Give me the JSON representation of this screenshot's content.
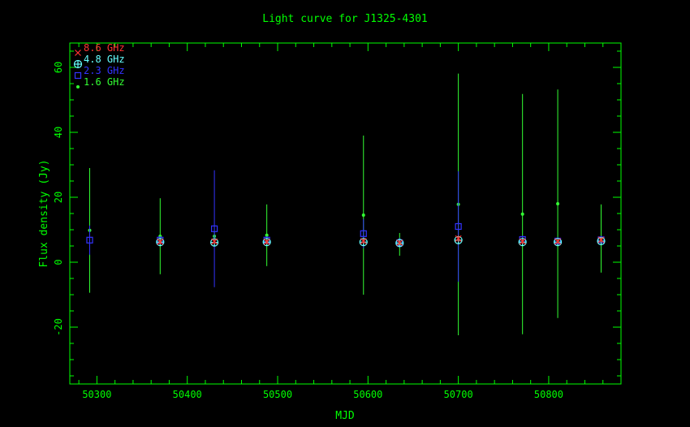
{
  "chart_data": {
    "type": "scatter",
    "title": "Light curve for J1325-4301",
    "xlabel": "MJD",
    "ylabel": "Flux density (Jy)",
    "xlim": [
      50270,
      50880
    ],
    "ylim": [
      -37.5,
      67.5
    ],
    "xticks": [
      50300,
      50400,
      50500,
      50600,
      50700,
      50800
    ],
    "yticks": [
      -20,
      0,
      20,
      40,
      60
    ],
    "axis_color": "#00ff00",
    "legend_position": "top-left",
    "series": [
      {
        "name": "8.6 GHz",
        "marker": "cross",
        "color": "#ff3333",
        "points": [
          {
            "x": 50370,
            "y": 6.3,
            "err": 0.8
          },
          {
            "x": 50430,
            "y": 6.4,
            "err": 0.8
          },
          {
            "x": 50488,
            "y": 6.3,
            "err": 0.8
          },
          {
            "x": 50595,
            "y": 6.5,
            "err": 0.8
          },
          {
            "x": 50635,
            "y": 6.0,
            "err": 0.8
          },
          {
            "x": 50700,
            "y": 7.3,
            "err": 1.0
          },
          {
            "x": 50771,
            "y": 6.4,
            "err": 0.8
          },
          {
            "x": 50810,
            "y": 6.4,
            "err": 0.8
          },
          {
            "x": 50858,
            "y": 6.9,
            "err": 0.8
          }
        ]
      },
      {
        "name": "4.8 GHz",
        "marker": "circle-plus",
        "color": "#66ffff",
        "points": [
          {
            "x": 50370,
            "y": 6.2,
            "err": 1.0
          },
          {
            "x": 50430,
            "y": 6.1,
            "err": 1.0
          },
          {
            "x": 50488,
            "y": 6.2,
            "err": 1.0
          },
          {
            "x": 50595,
            "y": 6.2,
            "err": 1.0
          },
          {
            "x": 50635,
            "y": 5.9,
            "err": 1.0
          },
          {
            "x": 50700,
            "y": 6.8,
            "err": 1.0
          },
          {
            "x": 50771,
            "y": 6.2,
            "err": 1.0
          },
          {
            "x": 50810,
            "y": 6.2,
            "err": 1.0
          },
          {
            "x": 50858,
            "y": 6.5,
            "err": 1.0
          }
        ]
      },
      {
        "name": "2.3 GHz",
        "marker": "square",
        "color": "#3333ff",
        "points": [
          {
            "x": 50292,
            "y": 6.8,
            "err": 4.5
          },
          {
            "x": 50370,
            "y": 6.8,
            "err": 1.2
          },
          {
            "x": 50430,
            "y": 10.3,
            "err": 18.0
          },
          {
            "x": 50488,
            "y": 6.8,
            "err": 1.2
          },
          {
            "x": 50595,
            "y": 8.8,
            "err": 4.5
          },
          {
            "x": 50635,
            "y": 6.0,
            "err": 1.5
          },
          {
            "x": 50700,
            "y": 11.0,
            "err": 17.0
          },
          {
            "x": 50771,
            "y": 7.0,
            "err": 1.2
          },
          {
            "x": 50810,
            "y": 6.5,
            "err": 1.2
          },
          {
            "x": 50858,
            "y": 6.9,
            "err": 1.2
          }
        ]
      },
      {
        "name": "1.6 GHz",
        "marker": "dot",
        "color": "#33ff33",
        "points": [
          {
            "x": 50292,
            "y": 9.8,
            "err": 19.2
          },
          {
            "x": 50370,
            "y": 8.0,
            "err": 11.7
          },
          {
            "x": 50430,
            "y": 8.0,
            "err": 1.5
          },
          {
            "x": 50488,
            "y": 8.3,
            "err": 9.5
          },
          {
            "x": 50595,
            "y": 14.5,
            "err": 24.5
          },
          {
            "x": 50635,
            "y": 5.5,
            "err": 3.5
          },
          {
            "x": 50700,
            "y": 17.8,
            "err": 40.3
          },
          {
            "x": 50771,
            "y": 14.8,
            "err": 37.0
          },
          {
            "x": 50810,
            "y": 18.0,
            "err": 35.2
          },
          {
            "x": 50858,
            "y": 7.3,
            "err": 10.5
          }
        ]
      }
    ]
  }
}
